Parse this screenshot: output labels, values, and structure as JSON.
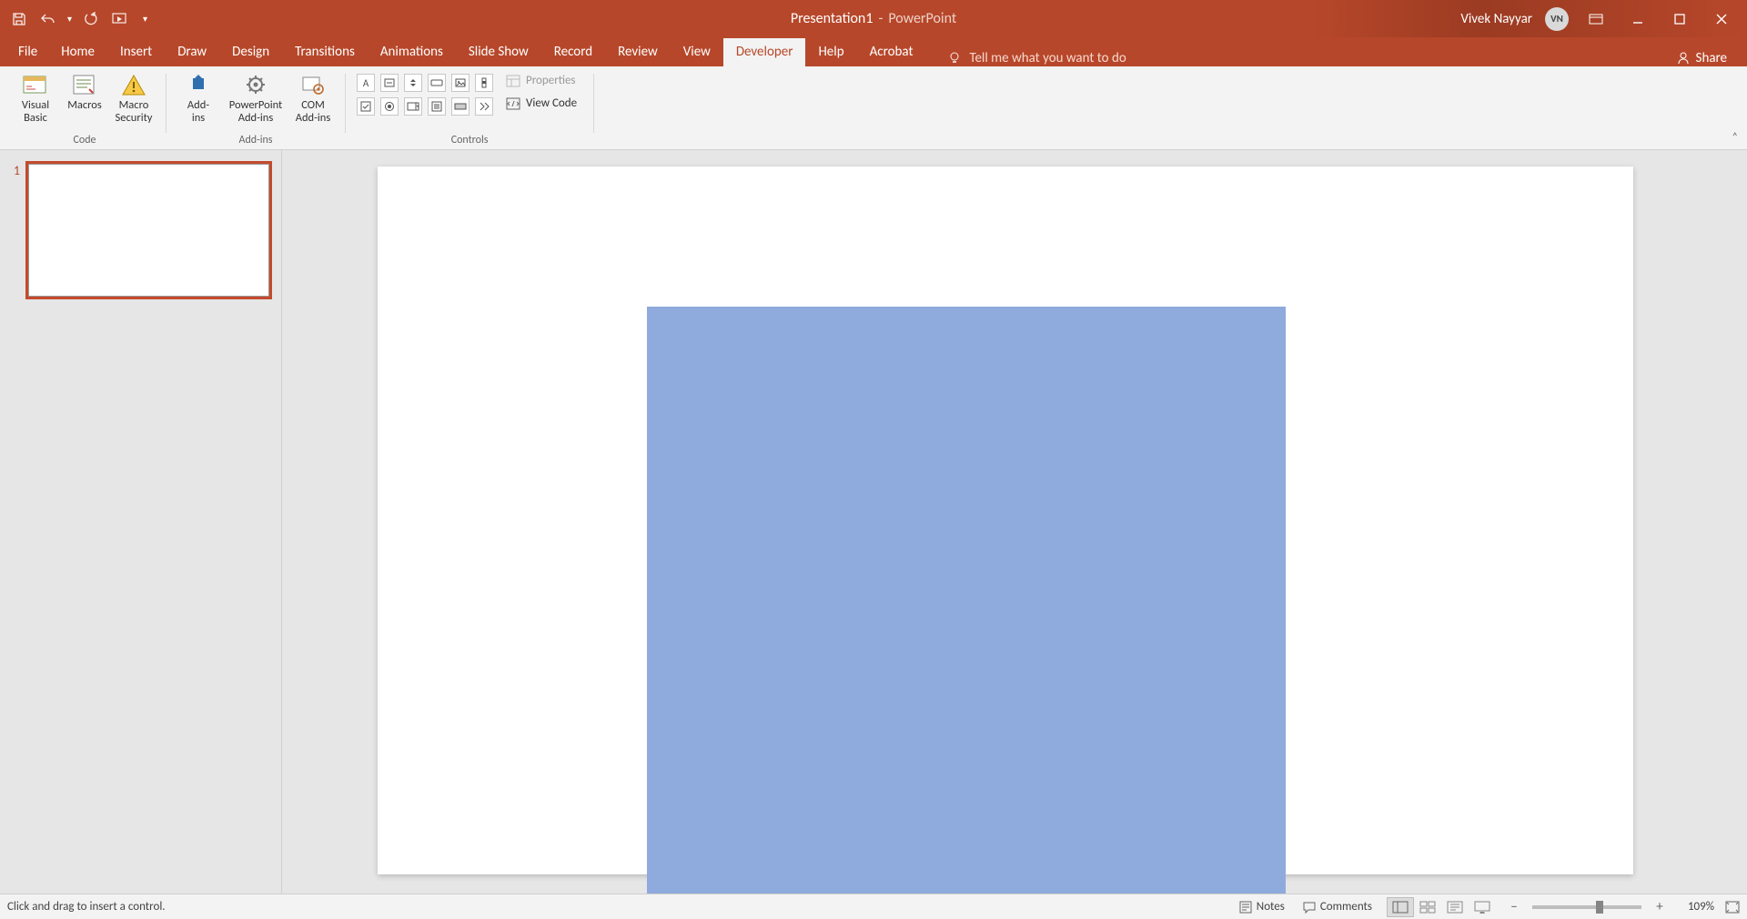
{
  "title": {
    "doc": "Presentation1",
    "sep": "-",
    "app": "PowerPoint"
  },
  "user": {
    "name": "Vivek Nayyar",
    "initials": "VN"
  },
  "tabs": [
    "File",
    "Home",
    "Insert",
    "Draw",
    "Design",
    "Transitions",
    "Animations",
    "Slide Show",
    "Record",
    "Review",
    "View",
    "Developer",
    "Help",
    "Acrobat"
  ],
  "active_tab": "Developer",
  "tell_me": "Tell me what you want to do",
  "share": "Share",
  "ribbon": {
    "groups": {
      "code": {
        "label": "Code",
        "visual_basic": "Visual\nBasic",
        "macros": "Macros",
        "macro_security": "Macro\nSecurity"
      },
      "addins": {
        "label": "Add-ins",
        "addins": "Add-\nins",
        "ppt_addins": "PowerPoint\nAdd-ins",
        "com_addins": "COM\nAdd-ins"
      },
      "controls": {
        "label": "Controls",
        "properties": "Properties",
        "view_code": "View Code"
      }
    }
  },
  "thumbs": [
    {
      "n": "1"
    }
  ],
  "status": {
    "left": "Click and drag to insert a control.",
    "notes": "Notes",
    "comments": "Comments",
    "zoom": "109%"
  }
}
